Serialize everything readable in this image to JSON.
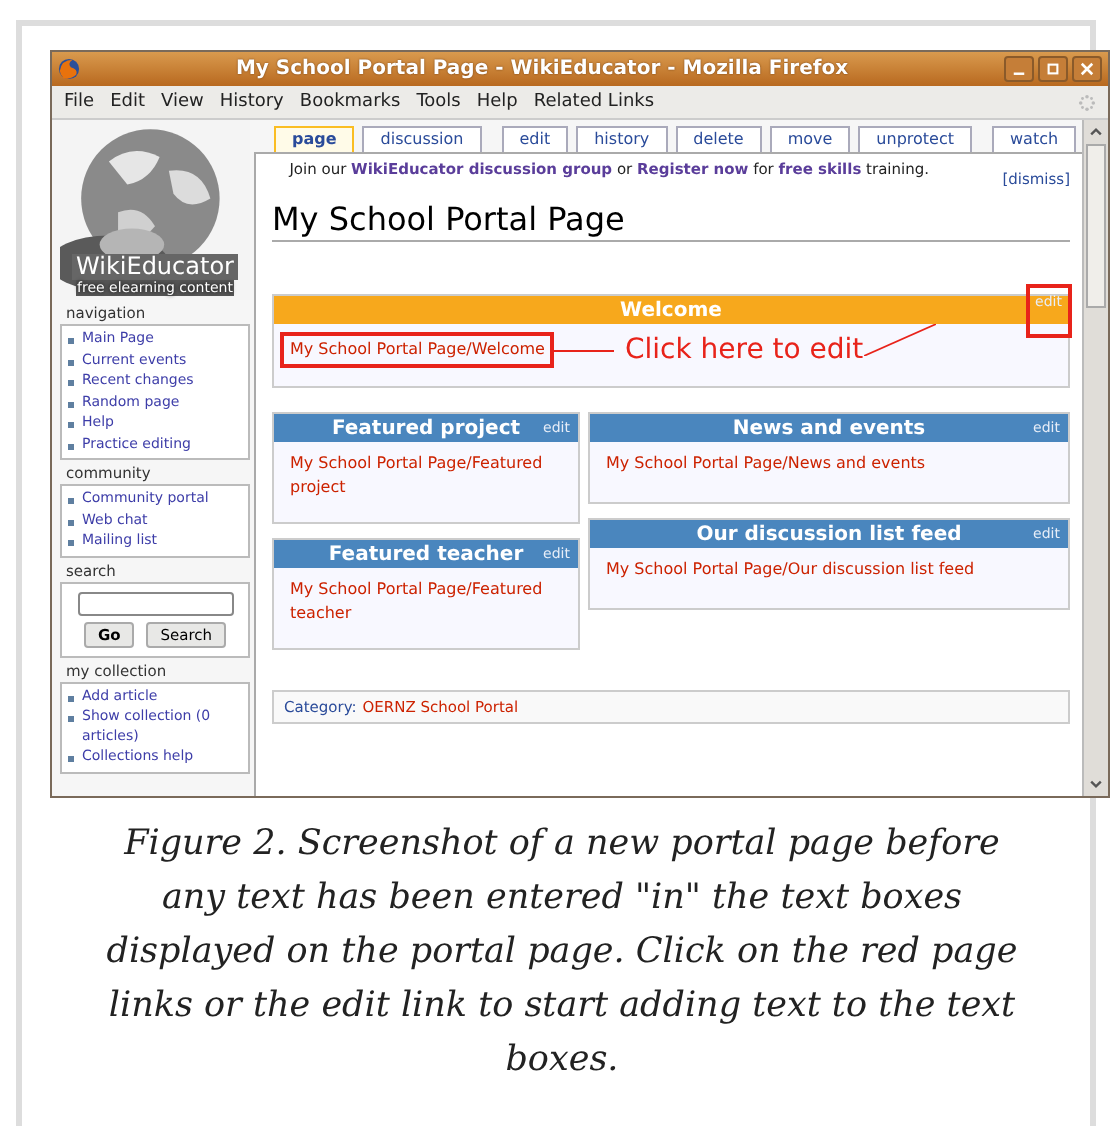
{
  "window": {
    "title": "My School Portal Page - WikiEducator - Mozilla Firefox"
  },
  "menu": [
    "File",
    "Edit",
    "View",
    "History",
    "Bookmarks",
    "Tools",
    "Help",
    "Related Links"
  ],
  "sidebar": {
    "logo_name": "WikiEducator",
    "logo_tagline": "free elearning content",
    "sections": [
      {
        "title": "navigation",
        "items": [
          "Main Page",
          "Current events",
          "Recent changes",
          "Random page",
          "Help",
          "Practice editing"
        ]
      },
      {
        "title": "community",
        "items": [
          "Community portal",
          "Web chat",
          "Mailing list"
        ]
      },
      {
        "title": "search",
        "kind": "search",
        "buttons": [
          "Go",
          "Search"
        ]
      },
      {
        "title": "my collection",
        "items": [
          "Add article",
          "Show collection (0 articles)",
          "Collections help"
        ]
      }
    ]
  },
  "tabs": [
    {
      "label": "page",
      "selected": true
    },
    {
      "label": "discussion",
      "selected": false
    },
    {
      "label": "edit",
      "selected": false
    },
    {
      "label": "history",
      "selected": false
    },
    {
      "label": "delete",
      "selected": false
    },
    {
      "label": "move",
      "selected": false
    },
    {
      "label": "unprotect",
      "selected": false
    },
    {
      "label": "watch",
      "selected": false
    }
  ],
  "notice": {
    "text": "Join our **WikiEducator discussion group** or **Register now** for **free skills** training.",
    "dismiss": "[dismiss]"
  },
  "page_title": "My School Portal Page",
  "welcome": {
    "title": "Welcome",
    "edit": "edit",
    "link": "My School Portal Page/Welcome",
    "highlighted": true
  },
  "callout": "Click here to edit",
  "left_column": [
    {
      "title": "Featured project",
      "edit": "edit",
      "link": "My School Portal Page/Featured project"
    },
    {
      "title": "Featured teacher",
      "edit": "edit",
      "link": "My School Portal Page/Featured teacher"
    }
  ],
  "right_column": [
    {
      "title": "News and events",
      "edit": "edit",
      "link": "My School Portal Page/News and events"
    },
    {
      "title": "Our discussion list feed",
      "edit": "edit",
      "link": "My School Portal Page/Our discussion list feed"
    }
  ],
  "category": {
    "label": "Category:",
    "link": "OERNZ School Portal"
  },
  "caption": "Figure 2. Screenshot of a new portal page before any text has been entered \"in\" the text boxes displayed on the portal page. Click on the red page links or the edit link to start adding text to the text boxes."
}
